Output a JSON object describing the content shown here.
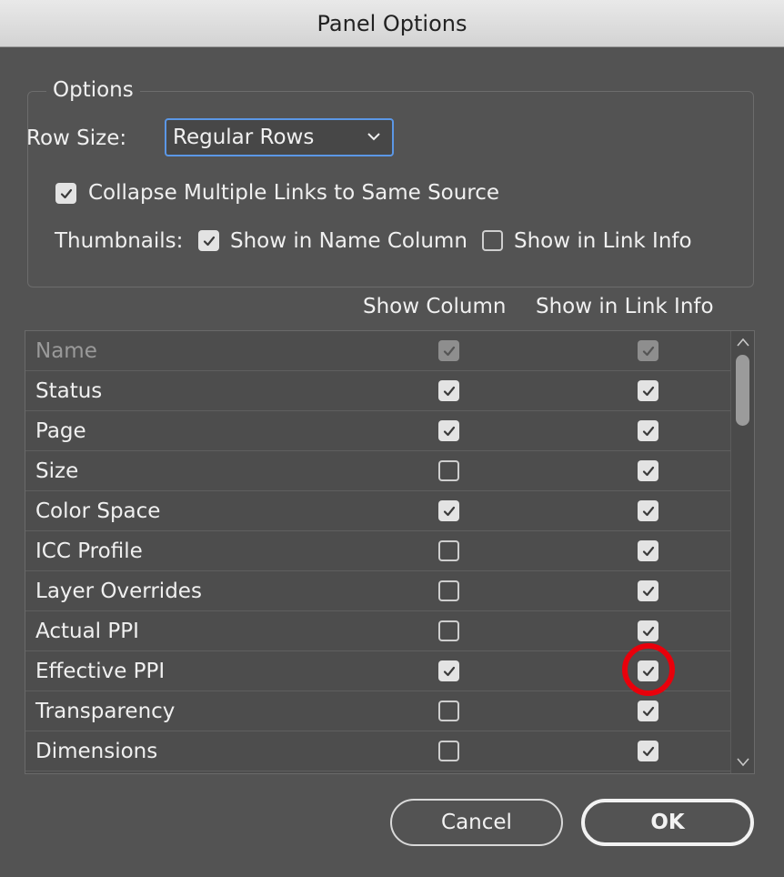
{
  "window": {
    "title": "Panel Options"
  },
  "options": {
    "legend": "Options",
    "row_size_label": "Row Size:",
    "row_size_value": "Regular Rows",
    "collapse_label": "Collapse Multiple Links to Same Source",
    "collapse_checked": true,
    "thumbnails_label": "Thumbnails:",
    "thumb_name_label": "Show in Name Column",
    "thumb_name_checked": true,
    "thumb_info_label": "Show in Link Info",
    "thumb_info_checked": false
  },
  "columns": {
    "show_column": "Show Column",
    "show_in_link_info": "Show in Link Info"
  },
  "rows": [
    {
      "name": "Name",
      "show_column": true,
      "show_in_link_info": true,
      "disabled": true
    },
    {
      "name": "Status",
      "show_column": true,
      "show_in_link_info": true
    },
    {
      "name": "Page",
      "show_column": true,
      "show_in_link_info": true
    },
    {
      "name": "Size",
      "show_column": false,
      "show_in_link_info": true
    },
    {
      "name": "Color Space",
      "show_column": true,
      "show_in_link_info": true
    },
    {
      "name": "ICC Profile",
      "show_column": false,
      "show_in_link_info": true
    },
    {
      "name": "Layer Overrides",
      "show_column": false,
      "show_in_link_info": true
    },
    {
      "name": "Actual PPI",
      "show_column": false,
      "show_in_link_info": true
    },
    {
      "name": "Effective PPI",
      "show_column": true,
      "show_in_link_info": true
    },
    {
      "name": "Transparency",
      "show_column": false,
      "show_in_link_info": true
    },
    {
      "name": "Dimensions",
      "show_column": false,
      "show_in_link_info": true
    }
  ],
  "buttons": {
    "cancel": "Cancel",
    "ok": "OK"
  },
  "colors": {
    "background": "#535353",
    "focus_ring": "#5b97e6",
    "annotation": "#e8000b"
  },
  "icons": {
    "checkmark": "checkmark-icon",
    "dropdown": "chevron-down-icon",
    "scroll_up": "chevron-up-icon",
    "scroll_down": "chevron-down-icon"
  }
}
